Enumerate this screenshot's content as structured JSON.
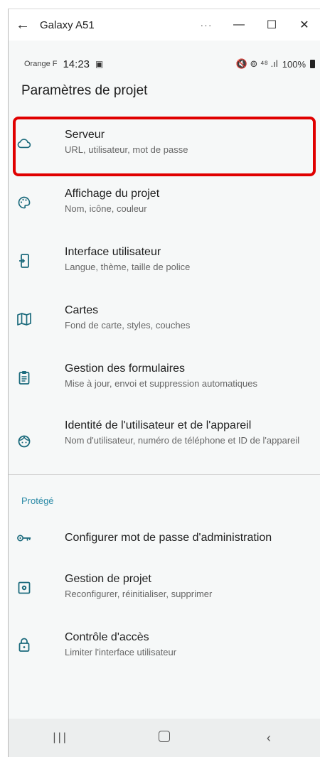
{
  "window": {
    "title": "Galaxy A51",
    "back_glyph": "←",
    "more_glyph": "···",
    "minimize_glyph": "—",
    "maximize_glyph": "☐",
    "close_glyph": "✕"
  },
  "status_bar": {
    "carrier": "Orange F",
    "time": "14:23",
    "notif_glyph": "▣",
    "indicators": "🔇 ⊚ ⁴⁸ .ıl",
    "battery": "100%"
  },
  "header": {
    "title": "Paramètres de projet"
  },
  "items": [
    {
      "title": "Serveur",
      "subtitle": "URL, utilisateur, mot de passe",
      "icon": "cloud-icon"
    },
    {
      "title": "Affichage du projet",
      "subtitle": "Nom, icône, couleur",
      "icon": "palette-icon"
    },
    {
      "title": "Interface utilisateur",
      "subtitle": "Langue, thème, taille de police",
      "icon": "phone-login-icon"
    },
    {
      "title": "Cartes",
      "subtitle": "Fond de carte, styles, couches",
      "icon": "map-icon"
    },
    {
      "title": "Gestion des formulaires",
      "subtitle": "Mise à jour, envoi et suppression automatiques",
      "icon": "clipboard-icon"
    },
    {
      "title": "Identité de l'utilisateur et de l'appareil",
      "subtitle": "Nom d'utilisateur, numéro de téléphone et ID de l'appareil",
      "icon": "face-icon"
    }
  ],
  "protected_section": {
    "label": "Protégé",
    "items": [
      {
        "title": "Configurer mot de passe d'administration",
        "icon": "key-icon"
      },
      {
        "title": "Gestion de projet",
        "subtitle": "Reconfigurer, réinitialiser, supprimer",
        "icon": "settings-box-icon"
      },
      {
        "title": "Contrôle d'accès",
        "subtitle": "Limiter l'interface utilisateur",
        "icon": "lock-icon"
      }
    ]
  },
  "nav": {
    "recents_glyph": "|||",
    "back_glyph": "‹"
  },
  "colors": {
    "accent": "#2b8aa6",
    "highlight": "#e00000",
    "icon": "#1c6b7d"
  }
}
